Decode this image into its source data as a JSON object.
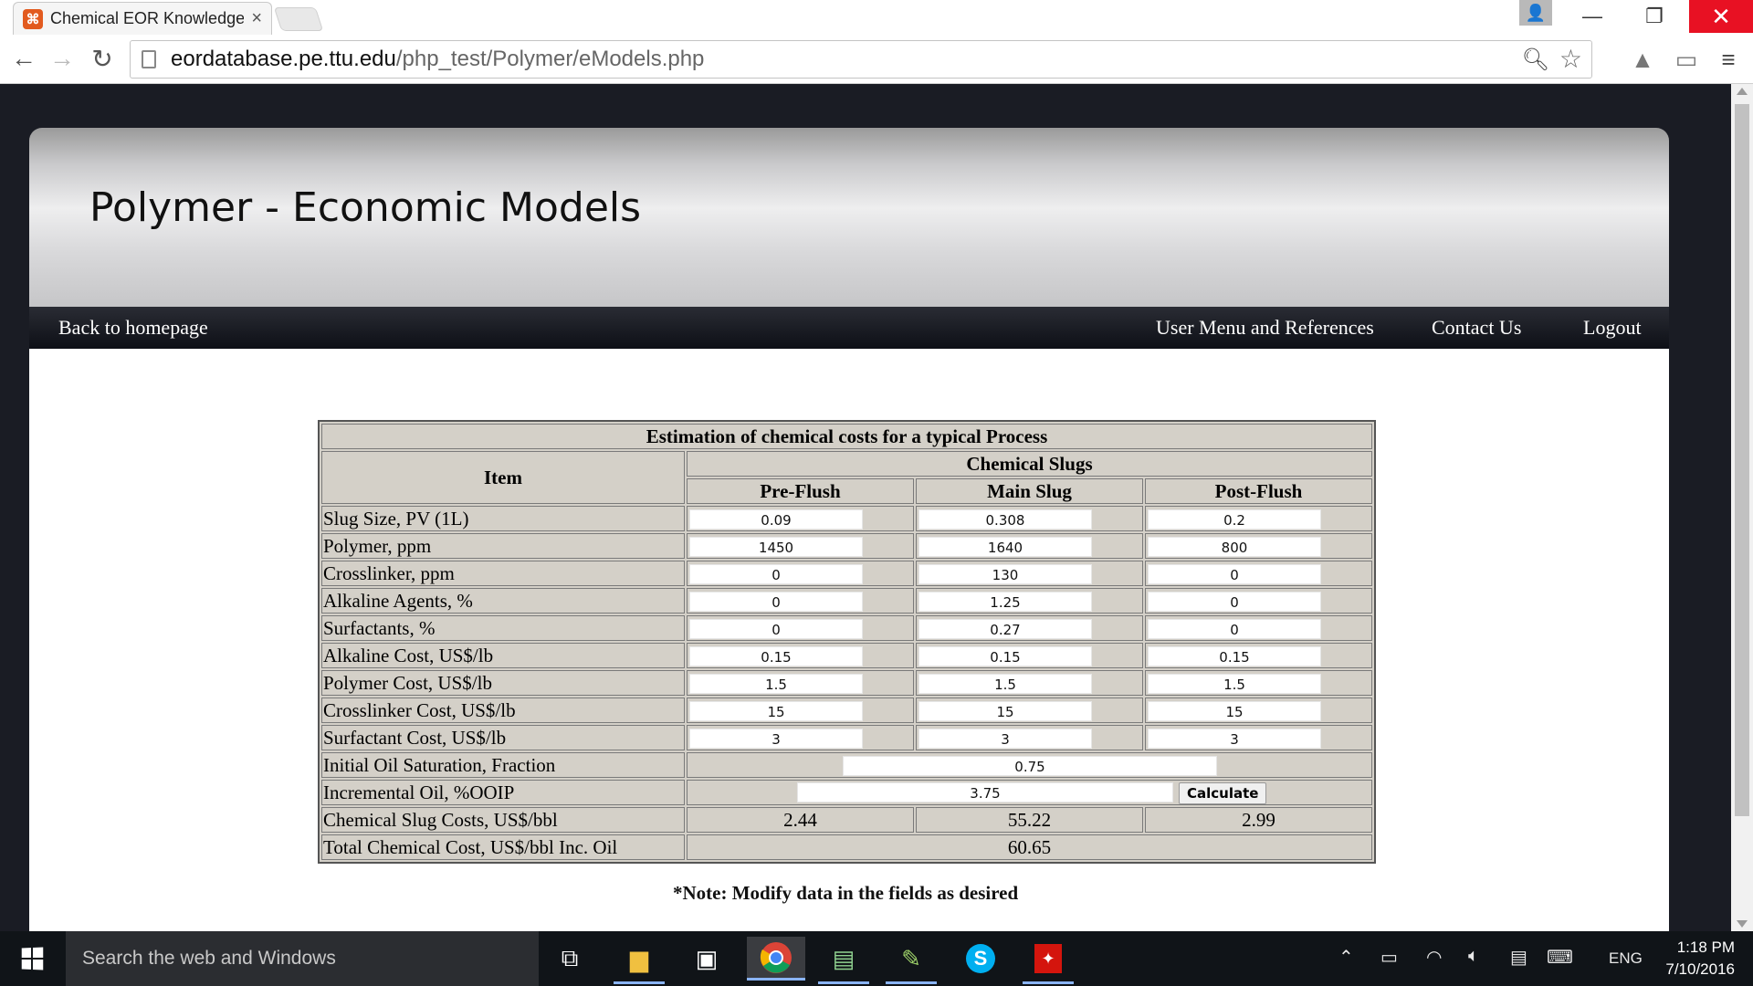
{
  "browser": {
    "tab_title": "Chemical EOR Knowledge",
    "tab_favicon": "⌘",
    "url_host": "eordatabase.pe.ttu.edu",
    "url_path": "/php_test/Polymer/eModels.php"
  },
  "site": {
    "title": "Polymer  -  Economic Models",
    "nav": {
      "home": "Back to homepage",
      "user_menu": "User Menu and References",
      "contact": "Contact Us",
      "logout": "Logout"
    }
  },
  "table": {
    "caption": "Estimation of chemical costs for a typical Process",
    "item_header": "Item",
    "group_header": "Chemical Slugs",
    "columns": [
      "Pre-Flush",
      "Main Slug",
      "Post-Flush"
    ],
    "input_rows": [
      {
        "label": "Slug Size, PV (1L)",
        "values": [
          "0.09",
          "0.308",
          "0.2"
        ]
      },
      {
        "label": "Polymer, ppm",
        "values": [
          "1450",
          "1640",
          "800"
        ]
      },
      {
        "label": "Crosslinker, ppm",
        "values": [
          "0",
          "130",
          "0"
        ]
      },
      {
        "label": "Alkaline Agents, %",
        "values": [
          "0",
          "1.25",
          "0"
        ]
      },
      {
        "label": "Surfactants, %",
        "values": [
          "0",
          "0.27",
          "0"
        ]
      },
      {
        "label": "Alkaline Cost, US$/lb",
        "values": [
          "0.15",
          "0.15",
          "0.15"
        ]
      },
      {
        "label": "Polymer Cost, US$/lb",
        "values": [
          "1.5",
          "1.5",
          "1.5"
        ]
      },
      {
        "label": "Crosslinker Cost, US$/lb",
        "values": [
          "15",
          "15",
          "15"
        ]
      },
      {
        "label": "Surfactant Cost, US$/lb",
        "values": [
          "3",
          "3",
          "3"
        ]
      }
    ],
    "oil_saturation": {
      "label": "Initial Oil Saturation, Fraction",
      "value": "0.75"
    },
    "incremental_oil": {
      "label": "Incremental Oil, %OOIP",
      "value": "3.75"
    },
    "calculate_label": "Calculate",
    "slug_costs": {
      "label": "Chemical Slug Costs, US$/bbl",
      "values": [
        "2.44",
        "55.22",
        "2.99"
      ]
    },
    "total_cost": {
      "label": "Total Chemical Cost, US$/bbl Inc. Oil",
      "value": "60.65"
    }
  },
  "note": "*Note: Modify data in the fields as desired",
  "taskbar": {
    "search_placeholder": "Search the web and Windows",
    "language": "ENG",
    "time": "1:18 PM",
    "date": "7/10/2016"
  },
  "colors": {
    "page_background": "#1a1c24",
    "table_background": "#d4d0c8",
    "close_button": "#e81123"
  }
}
